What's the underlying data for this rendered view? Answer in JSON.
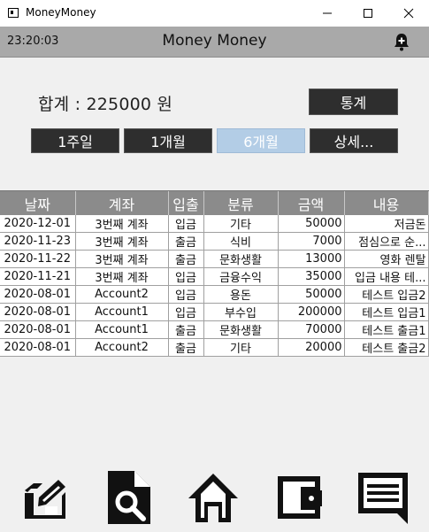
{
  "window": {
    "title": "MoneyMoney",
    "minimize_icon": "minimize-icon",
    "maximize_icon": "maximize-icon",
    "close_icon": "close-icon"
  },
  "header": {
    "time": "23:20:03",
    "title": "Money Money",
    "alert_icon": "bell-plus-icon"
  },
  "summary": {
    "label": "합계 : ",
    "amount": "225000",
    "unit": " 원"
  },
  "buttons": {
    "stats": "통계",
    "week": "1주일",
    "month": "1개월",
    "six_months": "6개월",
    "detail": "상세..."
  },
  "selected_period": "six_months",
  "table": {
    "headers": [
      "날짜",
      "계좌",
      "입출",
      "분류",
      "금액",
      "내용"
    ],
    "rows": [
      [
        "2020-12-01",
        "3번째 계좌",
        "입금",
        "기타",
        "50000",
        "저금돈"
      ],
      [
        "2020-11-23",
        "3번째 계좌",
        "출금",
        "식비",
        "7000",
        "점심으로 순..."
      ],
      [
        "2020-11-22",
        "3번째 계좌",
        "출금",
        "문화생활",
        "13000",
        "영화 렌탈"
      ],
      [
        "2020-11-21",
        "3번째 계좌",
        "입금",
        "금융수익",
        "35000",
        "입금 내용 테..."
      ],
      [
        "2020-08-01",
        "Account2",
        "입금",
        "용돈",
        "50000",
        "테스트 입금2"
      ],
      [
        "2020-08-01",
        "Account1",
        "입금",
        "부수입",
        "200000",
        "테스트 입금1"
      ],
      [
        "2020-08-01",
        "Account1",
        "출금",
        "문화생활",
        "70000",
        "테스트 출금1"
      ],
      [
        "2020-08-01",
        "Account2",
        "출금",
        "기타",
        "20000",
        "테스트 출금2"
      ]
    ]
  },
  "nav": [
    {
      "name": "edit-note-icon"
    },
    {
      "name": "search-document-icon"
    },
    {
      "name": "home-icon"
    },
    {
      "name": "wallet-icon"
    },
    {
      "name": "message-icon"
    }
  ],
  "colors": {
    "header_bg": "#a9a9a9",
    "button_bg": "#2e2e2e",
    "button_selected_bg": "#b3cde6",
    "table_header_bg": "#8b8b8b"
  }
}
